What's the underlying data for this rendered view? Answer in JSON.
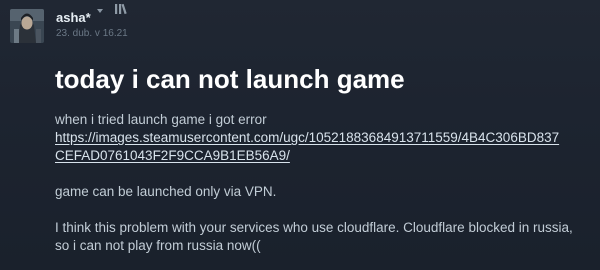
{
  "author": {
    "name": "asha*",
    "date": "23. dub. v 16.21",
    "avatar_icon": "avatar-image",
    "dropdown_icon": "chevron-down-icon",
    "badge_icon": "moderator-bars-icon"
  },
  "post": {
    "title": "today i can not launch game",
    "intro": "when i tried launch game i got error",
    "link_line1": "https://images.steamusercontent.com/ugc/1052188368491371155​9/4B4C306BD837",
    "link_line2": "CEFAD0761043F2F9CCA9B1EB56A9/",
    "paragraph2": "game can be launched only via VPN.",
    "paragraph3_line1": "I think this problem with your services who use cloudflare. Cloudflare blocked in russia,",
    "paragraph3_line2": "so i can not play from russia now(("
  },
  "colors": {
    "background": "#1d2430",
    "title": "#ffffff",
    "body_text": "#c2cdd6",
    "meta_text": "#6b7886"
  }
}
